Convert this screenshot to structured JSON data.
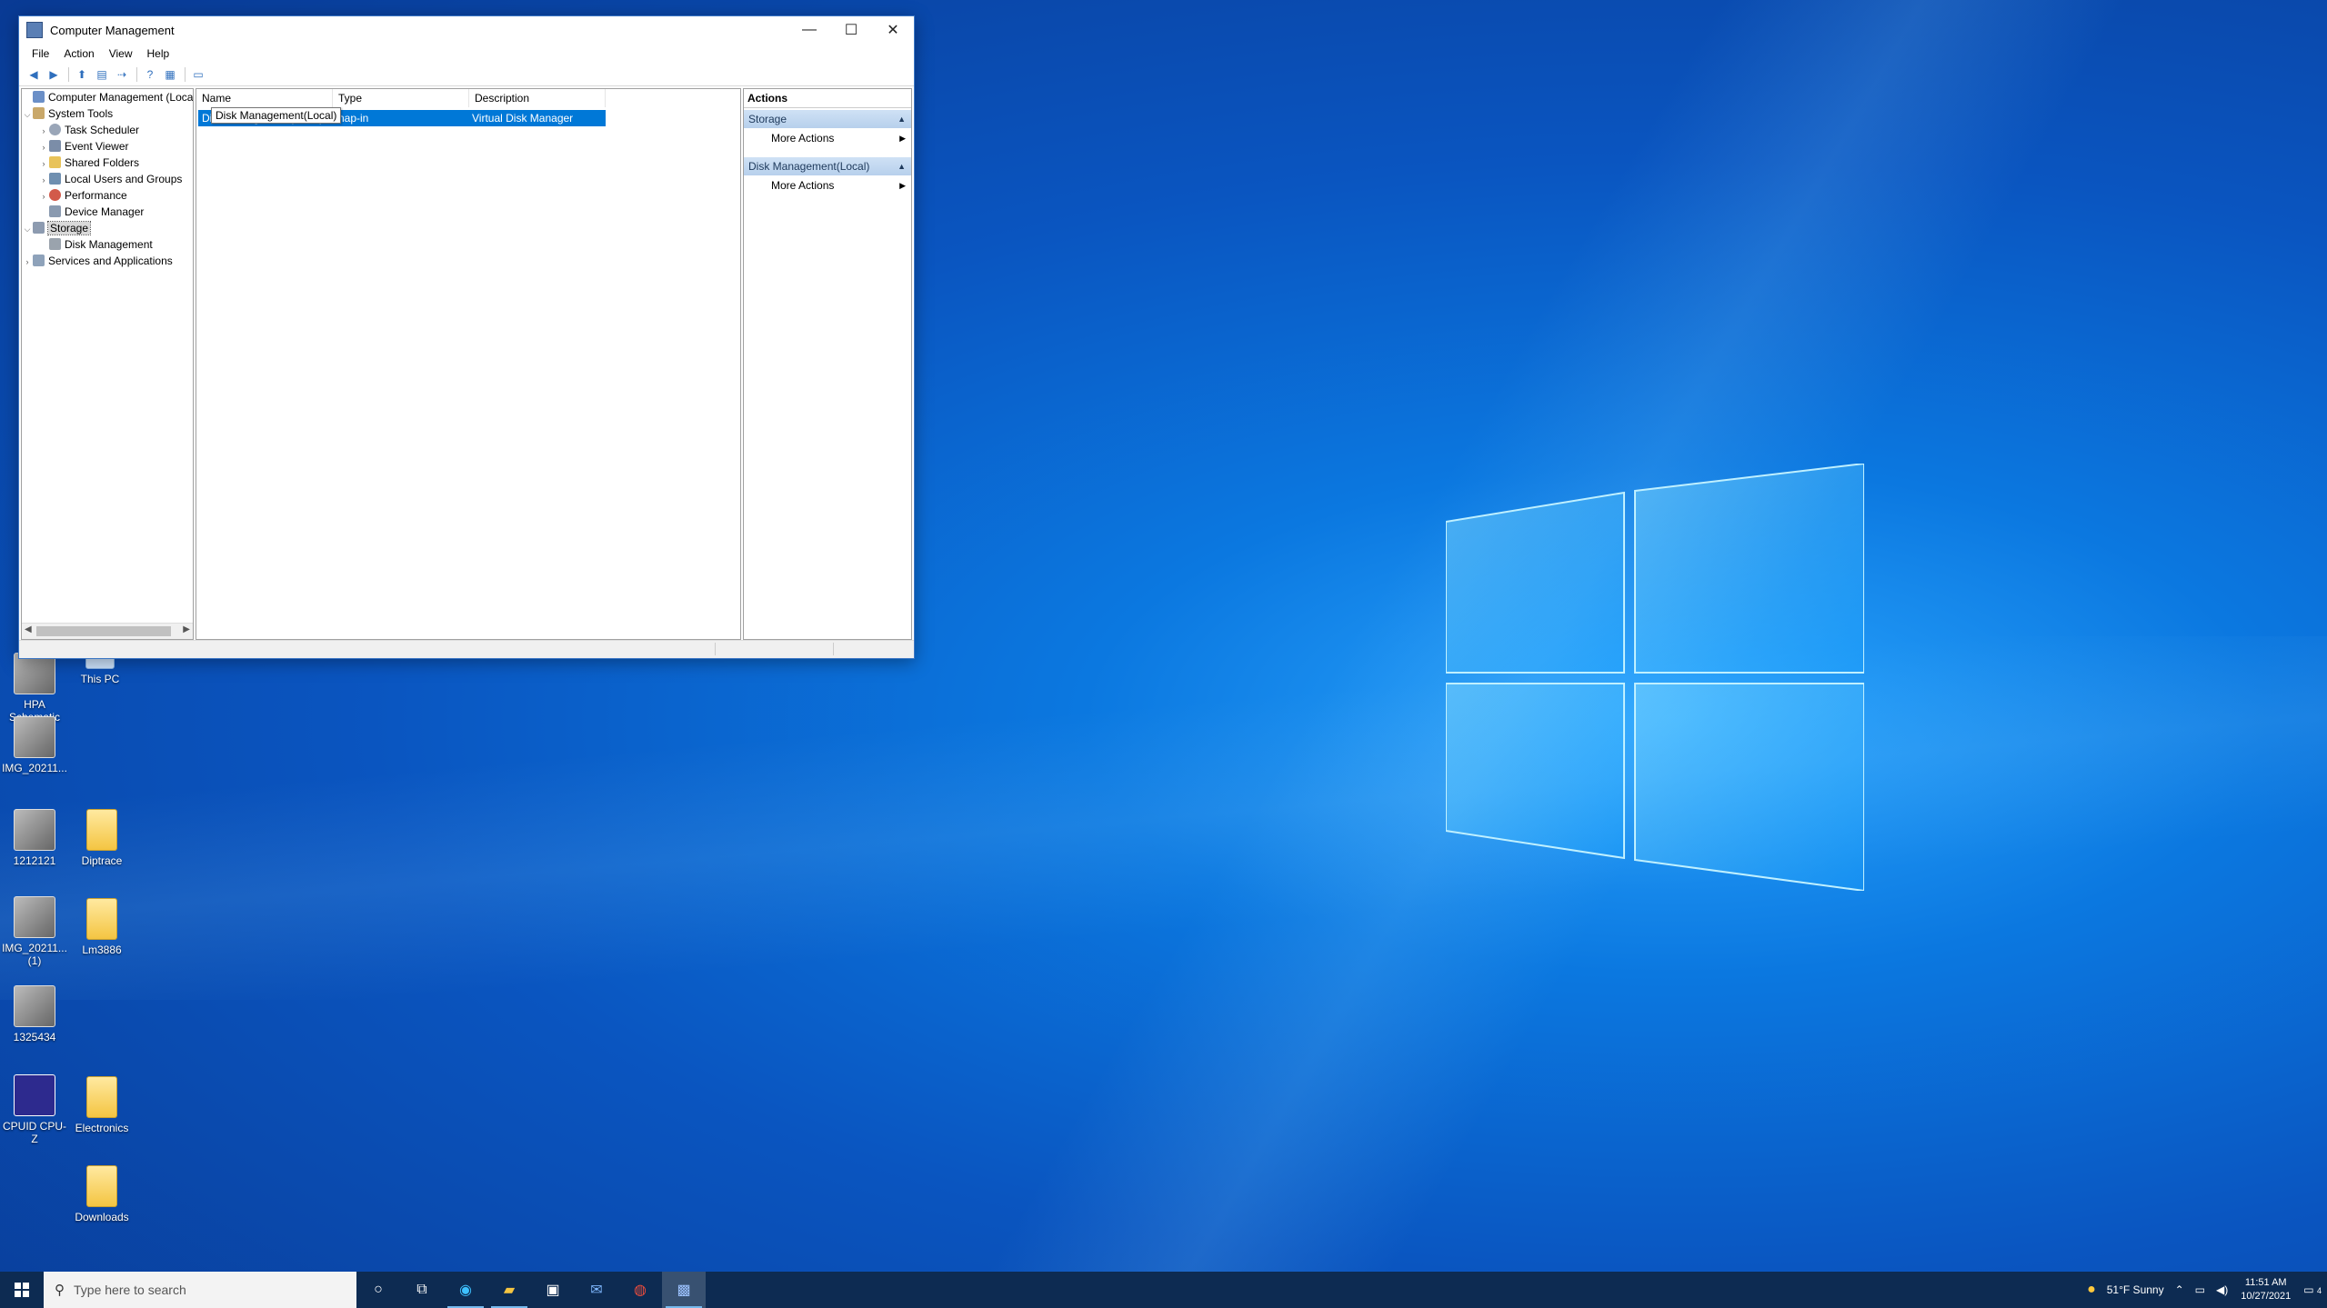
{
  "window": {
    "title": "Computer Management",
    "controls": {
      "minimize": "—",
      "maximize": "☐",
      "close": "✕"
    }
  },
  "menu": [
    "File",
    "Action",
    "View",
    "Help"
  ],
  "tree": {
    "root": "Computer Management (Local",
    "system_tools": "System Tools",
    "task_scheduler": "Task Scheduler",
    "event_viewer": "Event Viewer",
    "shared_folders": "Shared Folders",
    "local_users": "Local Users and Groups",
    "performance": "Performance",
    "device_manager": "Device Manager",
    "storage": "Storage",
    "disk_management": "Disk Management",
    "services": "Services and Applications"
  },
  "list": {
    "columns": [
      "Name",
      "Type",
      "Description"
    ],
    "row": {
      "name": "Disk Management(Local)",
      "type": "nap-in",
      "description": "Virtual Disk Manager"
    },
    "tooltip": "Disk Management(Local)"
  },
  "actions": {
    "header": "Actions",
    "section1": "Storage",
    "item1": "More Actions",
    "section2": "Disk Management(Local)",
    "item2": "More Actions"
  },
  "desktop_icons": [
    {
      "label": "HPA Schematic"
    },
    {
      "label": "This PC"
    },
    {
      "label": "IMG_20211..."
    },
    {
      "label": "1212121"
    },
    {
      "label": "Diptrace"
    },
    {
      "label": "IMG_20211... (1)"
    },
    {
      "label": "Lm3886"
    },
    {
      "label": "1325434"
    },
    {
      "label": "CPUID CPU-Z"
    },
    {
      "label": "Electronics"
    },
    {
      "label": "Downloads"
    }
  ],
  "taskbar": {
    "search_placeholder": "Type here to search",
    "weather": "51°F  Sunny",
    "time": "11:51 AM",
    "date": "10/27/2021",
    "notification_count": "4"
  },
  "colors": {
    "selection": "#0078d7",
    "taskbar": "#0d2b52",
    "action_section": "#b7d0ec"
  }
}
